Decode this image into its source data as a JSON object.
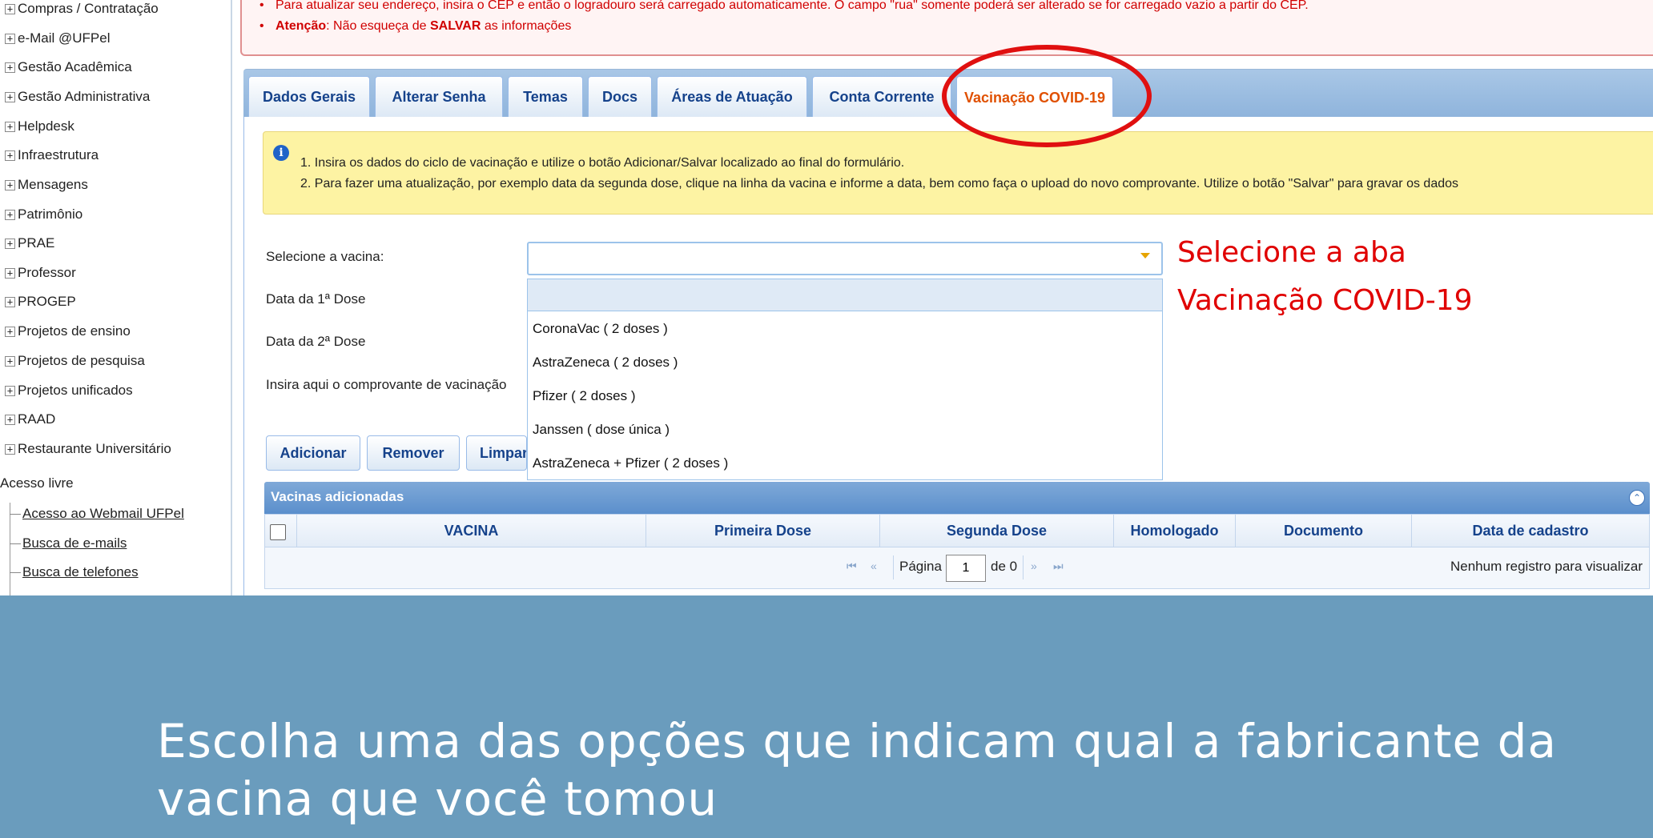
{
  "sidebar": {
    "items": [
      {
        "label": "Compras / Contratação"
      },
      {
        "label": "e-Mail @UFPel"
      },
      {
        "label": "Gestão Acadêmica"
      },
      {
        "label": "Gestão Administrativa"
      },
      {
        "label": "Helpdesk"
      },
      {
        "label": "Infraestrutura"
      },
      {
        "label": "Mensagens"
      },
      {
        "label": "Patrimônio"
      },
      {
        "label": "PRAE"
      },
      {
        "label": "Professor"
      },
      {
        "label": "PROGEP"
      },
      {
        "label": "Projetos de ensino"
      },
      {
        "label": "Projetos de pesquisa"
      },
      {
        "label": "Projetos unificados"
      },
      {
        "label": "RAAD"
      },
      {
        "label": "Restaurante Universitário"
      }
    ],
    "expand_glyph": "+",
    "free_access_label": "Acesso livre",
    "links": [
      {
        "label": "Acesso ao Webmail UFPel"
      },
      {
        "label": "Busca de e-mails"
      },
      {
        "label": "Busca de telefones"
      }
    ]
  },
  "notice": {
    "bullet": "•",
    "line1": "Para atualizar seu endereço, insira o CEP e então o logradouro será carregado automaticamente. O campo \"rua\" somente poderá ser alterado se for carregado vazio a partir do CEP.",
    "line2_strong": "Atenção",
    "line2_a": ": Não esqueça de ",
    "line2_strong2": "SALVAR",
    "line2_b": " as informações"
  },
  "tabs": [
    {
      "label": "Dados Gerais"
    },
    {
      "label": "Alterar Senha"
    },
    {
      "label": "Temas"
    },
    {
      "label": "Docs"
    },
    {
      "label": "Áreas de Atuação"
    },
    {
      "label": "Conta Corrente"
    },
    {
      "label": "Vacinação COVID-19",
      "active": true
    }
  ],
  "info": {
    "icon": "info-icon",
    "line1": "1. Insira os dados do ciclo de vacinação e utilize o botão Adicionar/Salvar localizado ao final do formulário.",
    "line2": "2. Para fazer uma atualização, por exemplo data da segunda dose, clique na linha da vacina e informe a data, bem como faça o upload do novo comprovante. Utilize o botão \"Salvar\" para gravar os dados"
  },
  "form": {
    "select_label": "Selecione a vacina:",
    "dose1_label": "Data da 1ª Dose",
    "dose2_label": "Data da 2ª Dose",
    "upload_label": "Insira aqui o comprovante de vacinação",
    "select_value": "",
    "options": [
      {
        "label": "CoronaVac ( 2 doses )"
      },
      {
        "label": "AstraZeneca ( 2 doses )"
      },
      {
        "label": "Pfizer ( 2 doses )"
      },
      {
        "label": "Janssen ( dose única )"
      },
      {
        "label": "AstraZeneca + Pfizer ( 2 doses )"
      }
    ]
  },
  "buttons": {
    "add": "Adicionar",
    "remove": "Remover",
    "clear": "Limpar"
  },
  "annotation": {
    "line1": "Selecione a aba",
    "line2": "Vacinação COVID-19",
    "color": "#e00000"
  },
  "grid": {
    "title": "Vacinas adicionadas",
    "collapse_glyph": "⌃",
    "columns": [
      "VACINA",
      "Primeira Dose",
      "Segunda Dose",
      "Homologado",
      "Documento",
      "Data de cadastro"
    ],
    "pager": {
      "page_label": "Página",
      "page_value": "1",
      "of_label": "de 0",
      "empty_text": "Nenhum registro para visualizar",
      "first_glyph": "⏮",
      "prev_glyph": "«",
      "next_glyph": "»",
      "last_glyph": "⏭"
    }
  },
  "caption": {
    "text": "Escolha uma das opções que indicam qual a fabricante da vacina que você tomou",
    "band_color": "#6a9cbd"
  }
}
